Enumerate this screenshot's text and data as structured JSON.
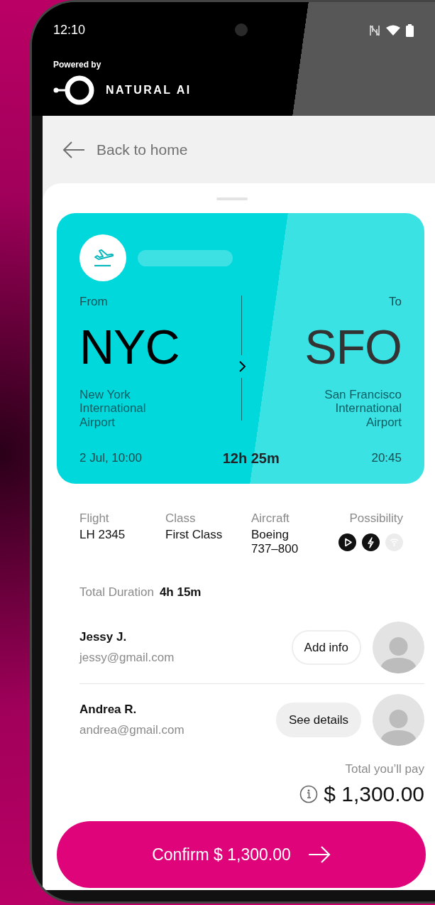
{
  "status_bar": {
    "time": "12:10"
  },
  "branding": {
    "powered_by": "Powered by",
    "logo_text": "NATURAL AI"
  },
  "header": {
    "back_label": "Back to home"
  },
  "flight_card": {
    "from_label": "From",
    "from_code": "NYC",
    "from_airport": "New York International Airport",
    "departure": "2 Jul, 10:00",
    "duration": "12h 25m",
    "to_label": "To",
    "to_code": "SFO",
    "to_airport": "San Francisco International Airport",
    "arrival": "20:45"
  },
  "details": [
    {
      "label": "Flight",
      "value": "LH 2345"
    },
    {
      "label": "Class",
      "value": "First Class"
    },
    {
      "label": "Aircraft",
      "value": "Boeing 737–800"
    }
  ],
  "possibility": {
    "label": "Possibility",
    "features": [
      {
        "kind": "play",
        "available": true
      },
      {
        "kind": "power",
        "available": true
      },
      {
        "kind": "wifi",
        "available": false
      }
    ]
  },
  "total_duration": {
    "label": "Total Duration",
    "value": "4h 15m"
  },
  "passengers": [
    {
      "name": "Jessy J.",
      "email": "jessy@gmail.com",
      "action": "Add info",
      "kind": "outline"
    },
    {
      "name": "Andrea R.",
      "email": "andrea@gmail.com",
      "action": "See details",
      "kind": "filled"
    }
  ],
  "total": {
    "label": "Total you’ll pay",
    "amount": "$ 1,300.00"
  },
  "confirm_button": {
    "label": "Confirm $ 1,300.00"
  }
}
